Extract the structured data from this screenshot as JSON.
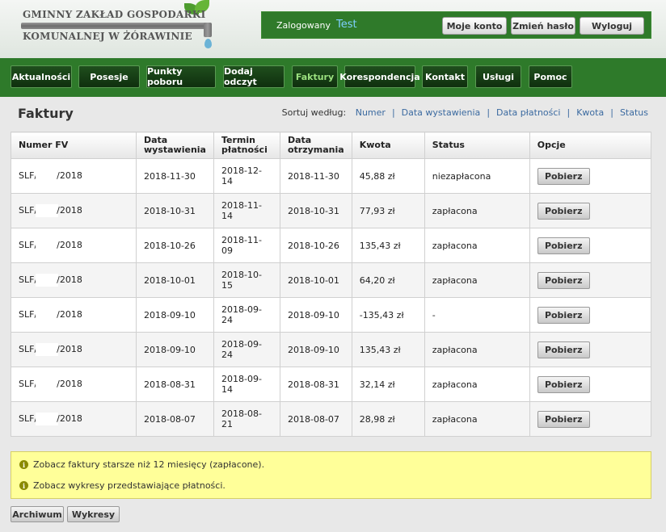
{
  "header": {
    "logo_line1": "GMINNY ZAKŁAD GOSPODARKI",
    "logo_line2": "KOMUNALNEJ W ŻÓRAWINIE",
    "logged_label": "Zalogowany",
    "username": "Test",
    "buttons": {
      "account": "Moje konto",
      "change_password": "Zmień hasło",
      "logout": "Wyloguj"
    }
  },
  "nav": {
    "items": [
      "Aktualności",
      "Posesje",
      "Punkty poboru",
      "Dodaj odczyt",
      "Faktury",
      "Korespondencja",
      "Kontakt",
      "Usługi",
      "Pomoc"
    ],
    "active": "Faktury"
  },
  "page": {
    "title": "Faktury",
    "sort_label": "Sortuj według:",
    "sort_options": [
      "Numer",
      "Data wystawienia",
      "Data płatności",
      "Kwota",
      "Status"
    ]
  },
  "table": {
    "headers": {
      "number": "Numer FV",
      "issue_date_1": "Data",
      "issue_date_2": "wystawienia",
      "due_date_1": "Termin",
      "due_date_2": "płatności",
      "received_1": "Data",
      "received_2": "otrzymania",
      "amount": "Kwota",
      "status": "Status",
      "options": "Opcje"
    },
    "rows": [
      {
        "prefix": "SLF/",
        "suffix": "/2018",
        "issue": "2018-11-30",
        "due": "2018-12-14",
        "received": "2018-11-30",
        "amount": "45,88 zł",
        "status": "niezapłacona",
        "status_type": "unpaid",
        "action": "Pobierz"
      },
      {
        "prefix": "SLF/",
        "suffix": "/2018",
        "issue": "2018-10-31",
        "due": "2018-11-14",
        "received": "2018-10-31",
        "amount": "77,93 zł",
        "status": "zapłacona",
        "status_type": "paid",
        "action": "Pobierz"
      },
      {
        "prefix": "SLF/",
        "suffix": "/2018",
        "issue": "2018-10-26",
        "due": "2018-11-09",
        "received": "2018-10-26",
        "amount": "135,43 zł",
        "status": "zapłacona",
        "status_type": "paid",
        "action": "Pobierz"
      },
      {
        "prefix": "SLF/",
        "suffix": "/2018",
        "issue": "2018-10-01",
        "due": "2018-10-15",
        "received": "2018-10-01",
        "amount": "64,20 zł",
        "status": "zapłacona",
        "status_type": "paid",
        "action": "Pobierz"
      },
      {
        "prefix": "SLF/",
        "suffix": "/2018",
        "issue": "2018-09-10",
        "due": "2018-09-24",
        "received": "2018-09-10",
        "amount": "-135,43 zł",
        "status": "-",
        "status_type": "none",
        "action": "Pobierz"
      },
      {
        "prefix": "SLF/",
        "suffix": "/2018",
        "issue": "2018-09-10",
        "due": "2018-09-24",
        "received": "2018-09-10",
        "amount": "135,43 zł",
        "status": "zapłacona",
        "status_type": "paid",
        "action": "Pobierz"
      },
      {
        "prefix": "SLF/",
        "suffix": "/2018",
        "issue": "2018-08-31",
        "due": "2018-09-14",
        "received": "2018-08-31",
        "amount": "32,14 zł",
        "status": "zapłacona",
        "status_type": "paid",
        "action": "Pobierz"
      },
      {
        "prefix": "SLF/",
        "suffix": "/2018",
        "issue": "2018-08-07",
        "due": "2018-08-21",
        "received": "2018-08-07",
        "amount": "28,98 zł",
        "status": "zapłacona",
        "status_type": "paid",
        "action": "Pobierz"
      }
    ]
  },
  "info": {
    "line1": "Zobacz faktury starsze niż 12 miesięcy (zapłacone).",
    "line2": "Zobacz wykresy przedstawiające płatności."
  },
  "bottom_buttons": {
    "archive": "Archiwum",
    "charts": "Wykresy"
  },
  "colors": {
    "nav_green": "#2e7a2a",
    "unpaid": "#cc1111",
    "paid": "#118811",
    "link": "#3b6aa0",
    "info_bg": "#ffff99"
  }
}
